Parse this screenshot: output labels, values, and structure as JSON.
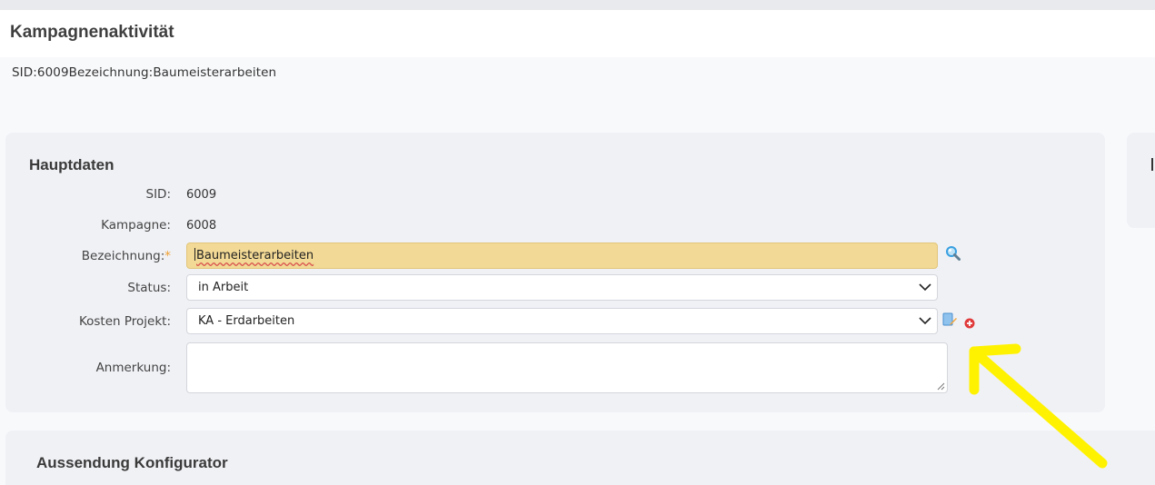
{
  "page": {
    "title": "Kampagnenaktivität",
    "subtitle": "SID:6009Bezeichnung:Baumeisterarbeiten"
  },
  "hauptdaten": {
    "title": "Hauptdaten",
    "sid_label": "SID:",
    "sid_value": "6009",
    "kampagne_label": "Kampagne:",
    "kampagne_value": "6008",
    "bezeichnung_label": "Bezeichnung:",
    "bezeichnung_required": "*",
    "bezeichnung_value": "Baumeisterarbeiten",
    "status_label": "Status:",
    "status_value": "in Arbeit",
    "kosten_label": "Kosten Projekt:",
    "kosten_value": "KA - Erdarbeiten",
    "anmerkung_label": "Anmerkung:",
    "anmerkung_value": ""
  },
  "aussendung": {
    "title": "Aussendung Konfigurator"
  },
  "icons": {
    "search": "search-icon",
    "edit": "edit-document-icon",
    "add": "add-circle-icon",
    "annotation": "yellow-arrow-annotation"
  },
  "colors": {
    "required_field_bg": "#f2d995",
    "annotation_arrow": "#fff200",
    "add_icon": "#e03a3a",
    "search_icon": "#3aa0e0"
  }
}
